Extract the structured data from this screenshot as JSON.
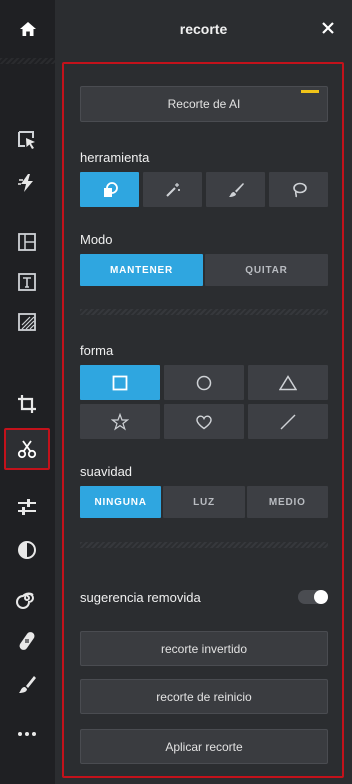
{
  "header": {
    "title": "recorte"
  },
  "toolbar": {
    "items": [
      {
        "name": "home-icon"
      },
      {
        "name": "select-icon"
      },
      {
        "name": "bolt-icon"
      },
      {
        "name": "layout-icon"
      },
      {
        "name": "text-icon"
      },
      {
        "name": "texture-icon"
      },
      {
        "name": "crop-icon"
      },
      {
        "name": "scissors-icon",
        "active": true
      },
      {
        "name": "adjust-icon"
      },
      {
        "name": "contrast-icon"
      },
      {
        "name": "swirl-icon"
      },
      {
        "name": "bandage-icon"
      },
      {
        "name": "brush-icon"
      },
      {
        "name": "more-icon"
      }
    ]
  },
  "panel": {
    "ai_button": "Recorte de AI",
    "tool_label": "herramienta",
    "tools": [
      {
        "name": "shape-tool-icon",
        "selected": true
      },
      {
        "name": "magic-wand-icon"
      },
      {
        "name": "brush-tool-icon"
      },
      {
        "name": "lasso-icon"
      }
    ],
    "mode_label": "Modo",
    "modes": [
      "MANTENER",
      "QUITAR"
    ],
    "mode_selected": "MANTENER",
    "shape_label": "forma",
    "shapes": [
      "square-shape-icon",
      "circle-shape-icon",
      "triangle-shape-icon",
      "star-shape-icon",
      "heart-shape-icon",
      "line-shape-icon"
    ],
    "shape_selected": "square-shape-icon",
    "softness_label": "suavidad",
    "softness": [
      "NINGUNA",
      "LUZ",
      "MEDIO"
    ],
    "softness_selected": "NINGUNA",
    "suggestion_label": "sugerencia removida",
    "suggestion_on": true,
    "invert_button": "recorte invertido",
    "reset_button": "recorte de reinicio",
    "apply_button": "Aplicar recorte"
  },
  "colors": {
    "accent": "#2fa6e0",
    "highlight": "#c3121b",
    "ai_badge": "#f0c419"
  }
}
